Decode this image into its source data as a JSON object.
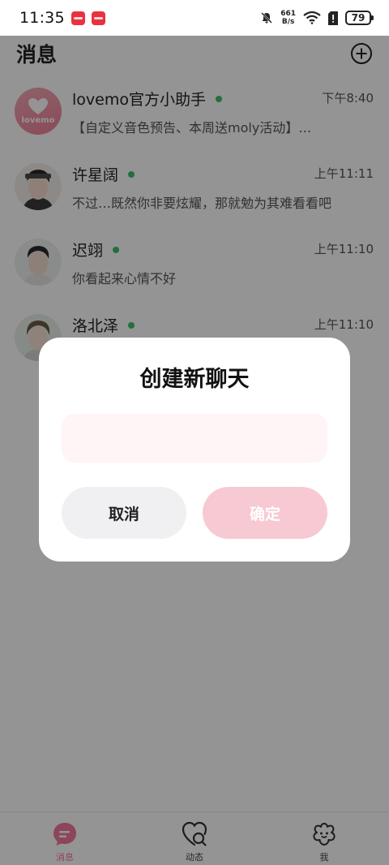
{
  "status_bar": {
    "time": "11:35",
    "net_speed_value": "661",
    "net_speed_unit": "B/s",
    "battery": "79"
  },
  "header": {
    "title": "消息"
  },
  "chats": [
    {
      "name": "lovemo官方小助手",
      "time": "下午8:40",
      "preview": "【自定义音色预告、本周送moly活动】…",
      "avatar_text": "lovemo"
    },
    {
      "name": "许星阔",
      "time": "上午11:11",
      "preview": "不过…既然你非要炫耀，那就勉为其难看看吧"
    },
    {
      "name": "迟翊",
      "time": "上午11:10",
      "preview": "你看起来心情不好"
    },
    {
      "name": "洛北泽",
      "time": "上午11:10",
      "preview": ""
    }
  ],
  "dialog": {
    "title": "创建新聊天",
    "input_value": "",
    "cancel_label": "取消",
    "confirm_label": "确定"
  },
  "tabs": [
    {
      "label": "消息",
      "icon": "chat-bubble-icon"
    },
    {
      "label": "动态",
      "icon": "moments-icon"
    },
    {
      "label": "我",
      "icon": "profile-flower-icon"
    }
  ],
  "colors": {
    "accent": "#f2789a",
    "online": "#3fbf6a",
    "confirm_disabled": "#f7c9d3",
    "input_bg": "#fff4f6"
  }
}
